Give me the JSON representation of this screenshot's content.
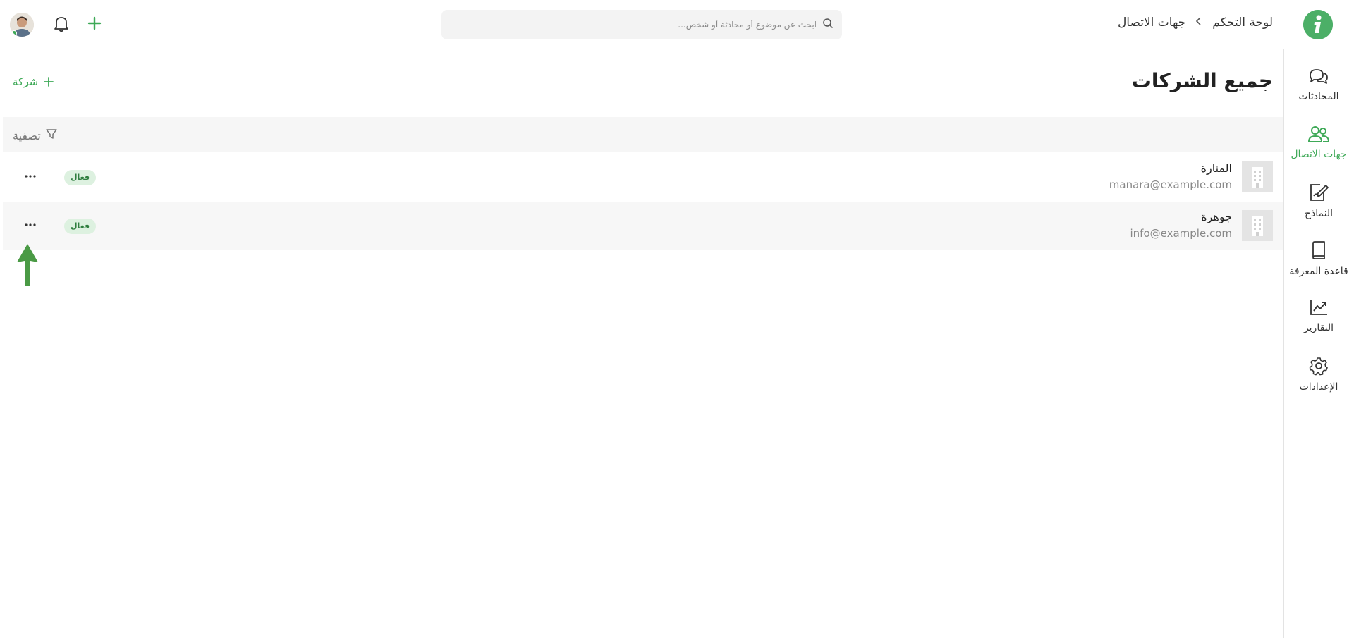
{
  "header": {
    "breadcrumb": {
      "root": "لوحة التحكم",
      "separator": "›",
      "current": "جهات الاتصال"
    },
    "search": {
      "placeholder": "ابحث عن موضوع أو محادثة أو شخص..."
    },
    "icons": [
      "logo-icon",
      "search-icon",
      "bell-icon",
      "plus-icon",
      "avatar"
    ],
    "accent_color": "#4caf67"
  },
  "sidebar": {
    "items": [
      {
        "label": "المحادثات",
        "icon": "chat-icon",
        "active": false
      },
      {
        "label": "جهات الاتصال",
        "icon": "contacts-icon",
        "active": true
      },
      {
        "label": "النماذج",
        "icon": "forms-icon",
        "active": false
      },
      {
        "label": "قاعدة المعرفة",
        "icon": "book-icon",
        "active": false
      },
      {
        "label": "التقارير",
        "icon": "chart-icon",
        "active": false
      },
      {
        "label": "الإعدادات",
        "icon": "gear-icon",
        "active": false
      }
    ]
  },
  "main": {
    "title": "جميع الشركات",
    "add_button_label": "شركة",
    "filter_label": "تصفية",
    "companies": [
      {
        "name": "المنارة",
        "email": "manara@example.com",
        "status": "فعال"
      },
      {
        "name": "جوهرة",
        "email": "info@example.com",
        "status": "فعال"
      }
    ],
    "more_label": "···"
  },
  "annotation": {
    "arrow_color": "#4a9a45"
  }
}
